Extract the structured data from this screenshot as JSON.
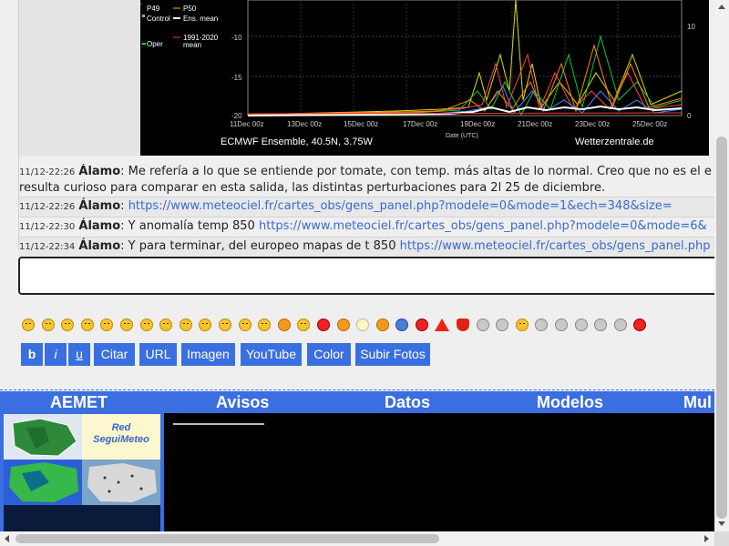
{
  "chart": {
    "legend": [
      "P49",
      "Control",
      "Oper",
      "P50",
      "Ens. mean",
      "1991-2020",
      "mean"
    ],
    "y_ticks_left": [
      "-10",
      "-15",
      "-20"
    ],
    "y_ticks_right": [
      "10",
      "0"
    ],
    "x_ticks": [
      "11Dec 00z",
      "13Dec 00z",
      "15Dec 00z",
      "17Dec 00z",
      "19Dec 00z",
      "21Dec 00z",
      "23Dec 00z",
      "25Dec 00z"
    ],
    "xlabel": "Date (UTC)",
    "caption_left": "ECMWF Ensemble, 40.5N, 3.75W",
    "caption_right": "Wetterzentrale.de"
  },
  "chat": {
    "messages": [
      {
        "time": "11/12-22:26",
        "user": "Álamo",
        "text": ": Me refería a lo que se entiende por tomate, con temp. más altas de lo normal. Creo que no es el e",
        "text2": "resulta curioso para comparar en esta salida, las distintas perturbaciones para 2l 25 de diciembre.",
        "link": ""
      },
      {
        "time": "11/12-22:26",
        "user": "Álamo",
        "text": ": ",
        "link": "https://www.meteociel.fr/cartes_obs/gens_panel.php?modele=0&mode=1&ech=348&size="
      },
      {
        "time": "11/12-22:30",
        "user": "Álamo",
        "text": ": Y anomalía temp 850 ",
        "link": "https://www.meteociel.fr/cartes_obs/gens_panel.php?modele=0&mode=6&"
      },
      {
        "time": "11/12-22:34",
        "user": "Álamo",
        "text": ": Y para terminar, del europeo mapas de t 850 ",
        "link": "https://www.meteociel.fr/cartes_obs/gens_panel.php"
      }
    ],
    "input_value": ""
  },
  "toolbar": {
    "bold": "b",
    "italic": "i",
    "underline": "u",
    "quote": "Citar",
    "url": "URL",
    "image": "Imagen",
    "youtube": "YouTube",
    "color": "Color",
    "upload": "Subir Fotos"
  },
  "nav": {
    "aemet": "AEMET",
    "avisos": "Avisos",
    "datos": "Datos",
    "modelos": "Modelos",
    "more": "Mul"
  },
  "thumbs": {
    "red_line1": "Red",
    "red_line2": "SeguiMeteo"
  },
  "colors": {
    "accent": "#3b6ee0",
    "link": "#3a6ccc"
  }
}
